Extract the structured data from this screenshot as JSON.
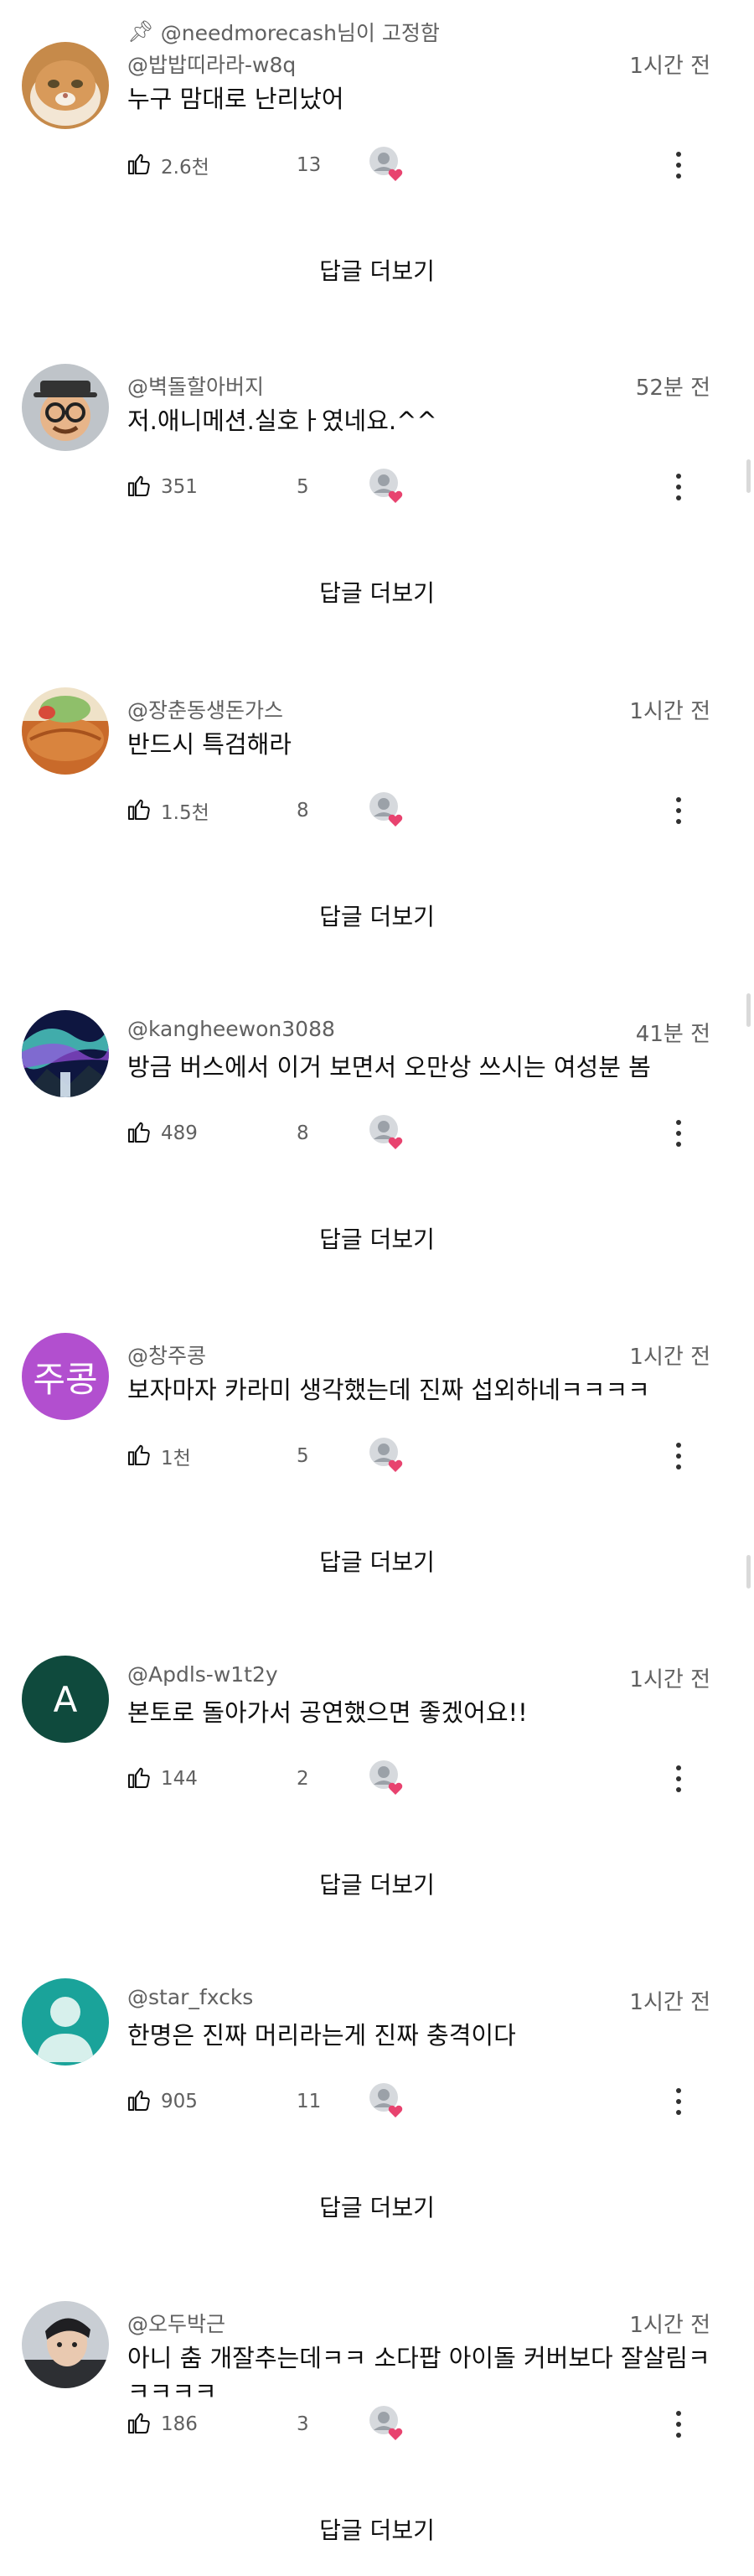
{
  "pinned": {
    "icon": "pin-icon",
    "label": "@needmorecash님이 고정함"
  },
  "more_replies_label": "답글 더보기",
  "comments": [
    {
      "handle": "@밥밥띠라라-w8q",
      "time": "1시간 전",
      "text": "누구 맘대로 난리났어",
      "likes": "2.6천",
      "replies": "13",
      "avatar_type": "cat",
      "avatar_color": "#c68a4a"
    },
    {
      "handle": "@벽돌할아버지",
      "time": "52분 전",
      "text": "저.애니메션.실호ㅏ였네요.^^",
      "likes": "351",
      "replies": "5",
      "avatar_type": "glasses-man",
      "avatar_color": "#9aa0a6"
    },
    {
      "handle": "@장춘동생돈가스",
      "time": "1시간 전",
      "text": "반드시 특검해라",
      "likes": "1.5천",
      "replies": "8",
      "avatar_type": "food",
      "avatar_color": "#d2773a"
    },
    {
      "handle": "@kangheewon3088",
      "time": "41분 전",
      "text": "방금 버스에서 이거 보면서 오만상 쓰시는 여성분 봄",
      "likes": "489",
      "replies": "8",
      "avatar_type": "aurora",
      "avatar_color": "#3b4aa8"
    },
    {
      "handle": "@창주콩",
      "time": "1시간 전",
      "text": "보자마자 카라미 생각했는데 진짜 섭외하네ㅋㅋㅋㅋ",
      "likes": "1천",
      "replies": "5",
      "avatar_type": "letters",
      "avatar_letters": "주콩",
      "avatar_color": "#b24fcf"
    },
    {
      "handle": "@Apdls-w1t2y",
      "time": "1시간 전",
      "text": "본토로 돌아가서 공연했으면 좋겠어요!!",
      "likes": "144",
      "replies": "2",
      "avatar_type": "letters",
      "avatar_letters": "A",
      "avatar_color": "#0f4a3d"
    },
    {
      "handle": "@star_fxcks",
      "time": "1시간 전",
      "text": "한명은 진짜 머리라는게 진짜 충격이다",
      "likes": "905",
      "replies": "11",
      "avatar_type": "default-person",
      "avatar_color": "#1aa39a"
    },
    {
      "handle": "@오두박근",
      "time": "1시간 전",
      "text": "아니 춤 개잘추는데ㅋㅋ 소다팝 아이돌 커버보다 잘살림ㅋㅋㅋㅋㅋ",
      "likes": "186",
      "replies": "3",
      "avatar_type": "photo-person",
      "avatar_color": "#6b7b8c"
    }
  ],
  "icons": {
    "like": "thumbs-up-icon",
    "dislike": "thumbs-down-icon",
    "reply": "reply-comment-icon",
    "creator_heart": "creator-heart-icon",
    "more": "more-vertical-icon"
  },
  "colors": {
    "heart": "#e8436f",
    "meta_text": "#606060",
    "primary_text": "#0f0f0f"
  }
}
